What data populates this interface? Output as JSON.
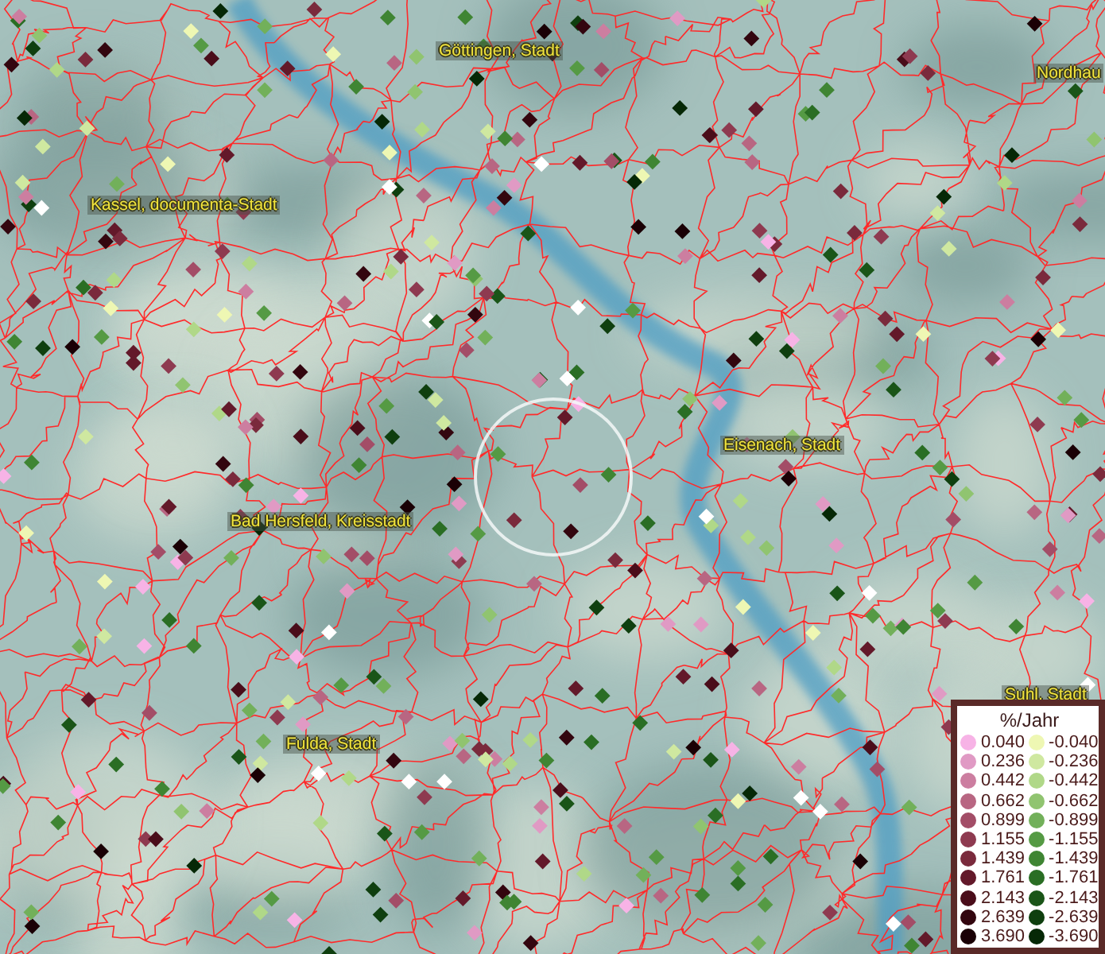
{
  "map": {
    "labels": [
      {
        "text": "Göttingen, Stadt"
      },
      {
        "text": "Nordhau"
      },
      {
        "text": "Kassel, documenta-Stadt"
      },
      {
        "text": "Eisenach, Stadt"
      },
      {
        "text": "Bad Hersfeld, Kreisstadt"
      },
      {
        "text": "Fulda, Stadt"
      },
      {
        "text": "Suhl, Stadt"
      }
    ]
  },
  "legend": {
    "title": "%/Jahr",
    "positive": [
      {
        "label": "0.040",
        "color": "#f7b3e6"
      },
      {
        "label": "0.236",
        "color": "#e09ac4"
      },
      {
        "label": "0.442",
        "color": "#cc7ea0"
      },
      {
        "label": "0.662",
        "color": "#b86682"
      },
      {
        "label": "0.899",
        "color": "#a34d67"
      },
      {
        "label": "1.155",
        "color": "#8e3a50"
      },
      {
        "label": "1.439",
        "color": "#7a2a3c"
      },
      {
        "label": "1.761",
        "color": "#63192a"
      },
      {
        "label": "2.143",
        "color": "#4a0d1a"
      },
      {
        "label": "2.639",
        "color": "#33060f"
      },
      {
        "label": "3.690",
        "color": "#1a0005"
      }
    ],
    "negative": [
      {
        "label": "-0.040",
        "color": "#eef7b3"
      },
      {
        "label": "-0.236",
        "color": "#cfe8a0"
      },
      {
        "label": "-0.442",
        "color": "#b0d888"
      },
      {
        "label": "-0.662",
        "color": "#90c470"
      },
      {
        "label": "-0.899",
        "color": "#72b05a"
      },
      {
        "label": "-1.155",
        "color": "#559a44"
      },
      {
        "label": "-1.439",
        "color": "#3f8533"
      },
      {
        "label": "-1.761",
        "color": "#2a6e24"
      },
      {
        "label": "-2.143",
        "color": "#1a5518"
      },
      {
        "label": "-2.639",
        "color": "#0f3f0f"
      },
      {
        "label": "-3.690",
        "color": "#062806"
      }
    ]
  }
}
